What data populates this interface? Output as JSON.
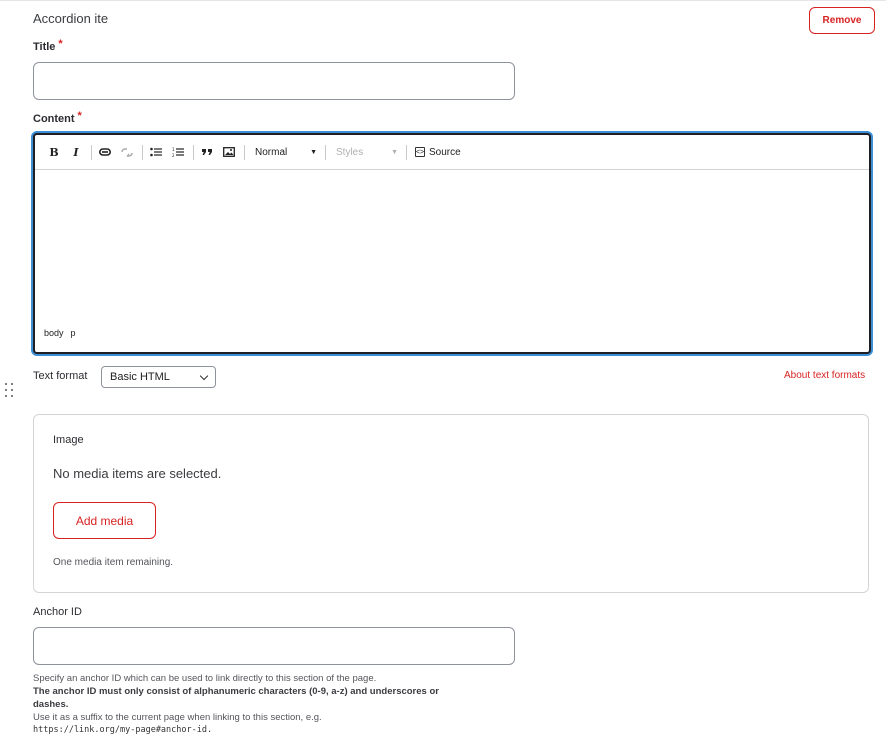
{
  "section": {
    "title": "Accordion ite",
    "remove_label": "Remove"
  },
  "title_field": {
    "label": "Title",
    "required_mark": "*",
    "value": ""
  },
  "content_field": {
    "label": "Content",
    "required_mark": "*",
    "toolbar": {
      "bold": "B",
      "italic": "I",
      "format_value": "Normal",
      "styles_value": "Styles",
      "source_label": "Source"
    },
    "path": [
      "body",
      "p"
    ]
  },
  "text_format": {
    "label": "Text format",
    "selected": "Basic HTML",
    "about_link": "About text formats"
  },
  "image": {
    "title": "Image",
    "empty_message": "No media items are selected.",
    "add_label": "Add media",
    "remaining": "One media item remaining."
  },
  "anchor": {
    "label": "Anchor ID",
    "value": "",
    "help_line1": "Specify an anchor ID which can be used to link directly to this section of the page.",
    "help_bold": "The anchor ID must only consist of alphanumeric characters (0-9, a-z) and underscores or dashes.",
    "help_line3": "Use it as a suffix to the current page when linking to this section, e.g.",
    "help_example": "https://link.org/my-page#anchor-id."
  },
  "colors": {
    "accent": "#d72222",
    "focus_ring": "#3b8fd6",
    "border": "#8e929c"
  }
}
